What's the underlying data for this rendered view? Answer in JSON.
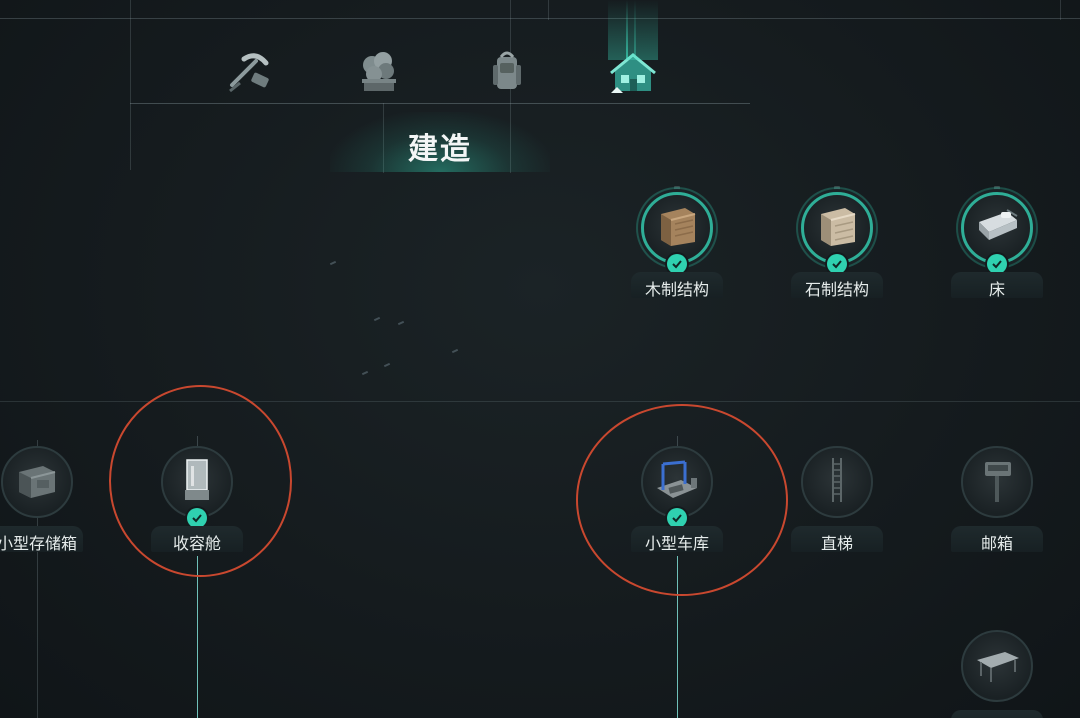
{
  "header": {
    "categories": [
      {
        "id": "tools",
        "icon": "pickaxe-icon",
        "active": false
      },
      {
        "id": "farming",
        "icon": "plant-icon",
        "active": false
      },
      {
        "id": "gear",
        "icon": "backpack-icon",
        "active": false
      },
      {
        "id": "building",
        "icon": "house-icon",
        "active": true
      }
    ],
    "tab_title": "建造"
  },
  "tree": {
    "row1": [
      {
        "label": "木制结构",
        "icon": "wood-crate-icon",
        "unlocked": true
      },
      {
        "label": "石制结构",
        "icon": "stone-crate-icon",
        "unlocked": true
      },
      {
        "label": "床",
        "icon": "bed-icon",
        "unlocked": true
      }
    ],
    "row2": [
      {
        "label": "小型存储箱",
        "icon": "storage-box-icon",
        "unlocked": false
      },
      {
        "label": "收容舱",
        "icon": "containment-pod-icon",
        "unlocked": true,
        "highlighted": true
      },
      {
        "label": "小型车库",
        "icon": "garage-icon",
        "unlocked": true,
        "highlighted": true
      },
      {
        "label": "直梯",
        "icon": "ladder-icon",
        "unlocked": false
      },
      {
        "label": "邮箱",
        "icon": "mailbox-icon",
        "unlocked": false
      }
    ],
    "row3": [
      {
        "label": "",
        "icon": "table-icon",
        "unlocked": false
      }
    ]
  },
  "colors": {
    "accent": "#2fd1b0",
    "ring_unlocked": "#2fae97",
    "highlight": "#c9482f",
    "background": "#141a1d"
  }
}
